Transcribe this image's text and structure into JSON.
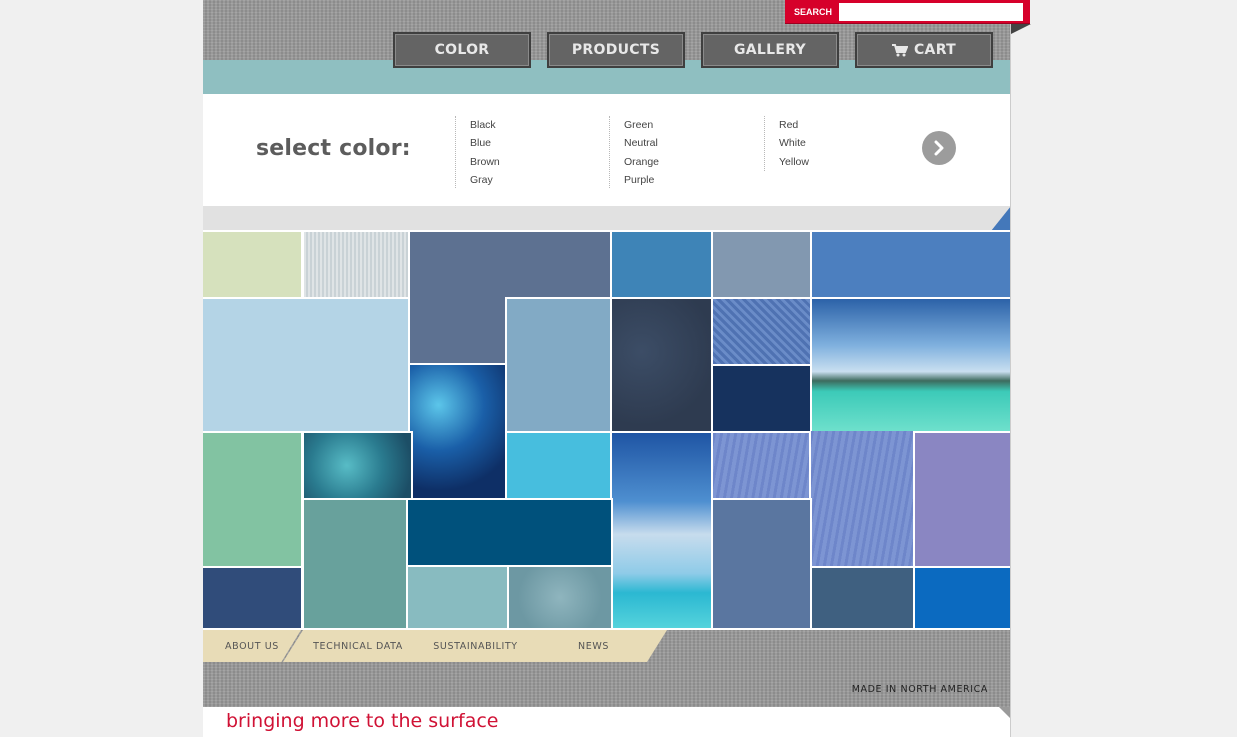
{
  "search": {
    "label": "SEARCH",
    "placeholder": ""
  },
  "nav": [
    {
      "label": "COLOR"
    },
    {
      "label": "PRODUCTS"
    },
    {
      "label": "GALLERY"
    },
    {
      "label": "CART",
      "icon": "cart-icon"
    }
  ],
  "colors": {
    "title": "select color:",
    "columns": [
      [
        "Black",
        "Blue",
        "Brown",
        "Gray"
      ],
      [
        "Green",
        "Neutral",
        "Orange",
        "Purple"
      ],
      [
        "Red",
        "White",
        "Yellow"
      ]
    ],
    "next_icon": "chevron-right-icon"
  },
  "footer": {
    "tabs": [
      "ABOUT US",
      "TECHNICAL DATA",
      "SUSTAINABILITY",
      "NEWS"
    ],
    "made_in": "MADE IN NORTH AMERICA"
  },
  "tagline": "bringing more to the surface",
  "theme": {
    "accent": "#d6002a",
    "teal": "#8fbfc1",
    "tab_beige": "#e8dcb7"
  }
}
